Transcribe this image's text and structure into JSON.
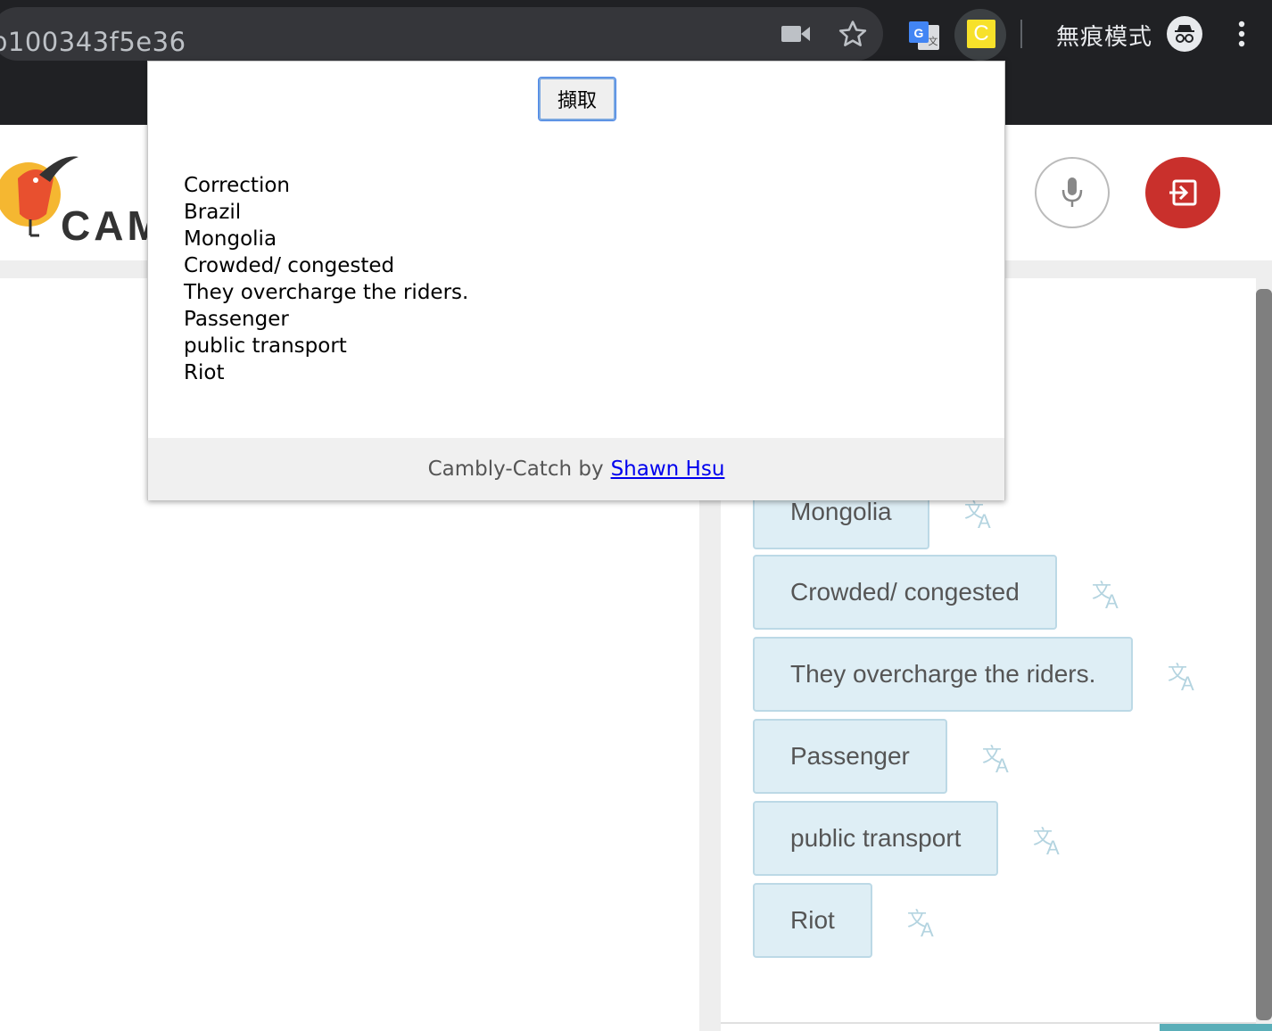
{
  "browser": {
    "url_fragment": "b100343f5e36",
    "extension_label": "C",
    "incognito_label": "無痕模式"
  },
  "site": {
    "logo_text": "CAM"
  },
  "popup": {
    "capture_button_label": "擷取",
    "captured_phrases": [
      "Correction",
      "Brazil",
      "Mongolia",
      "Crowded/ congested",
      "They overcharge the riders.",
      "Passenger",
      "public transport",
      "Riot"
    ],
    "footer_prefix": "Cambly-Catch by",
    "footer_author": "Shawn Hsu"
  },
  "phrase_cards": [
    {
      "text": "Mongolia"
    },
    {
      "text": "Crowded/ congested"
    },
    {
      "text": "They overcharge the riders."
    },
    {
      "text": "Passenger"
    },
    {
      "text": "public transport"
    },
    {
      "text": "Riot"
    }
  ],
  "colors": {
    "exit_button": "#c9302c",
    "chip_bg": "#deeef5",
    "extension_yellow": "#f7e12a",
    "link": "#0000ee"
  },
  "icons": [
    "video-camera-icon",
    "star-icon",
    "google-translate-icon",
    "extension-icon",
    "incognito-icon",
    "more-menu-icon",
    "microphone-icon",
    "exit-icon",
    "translate-icon"
  ]
}
